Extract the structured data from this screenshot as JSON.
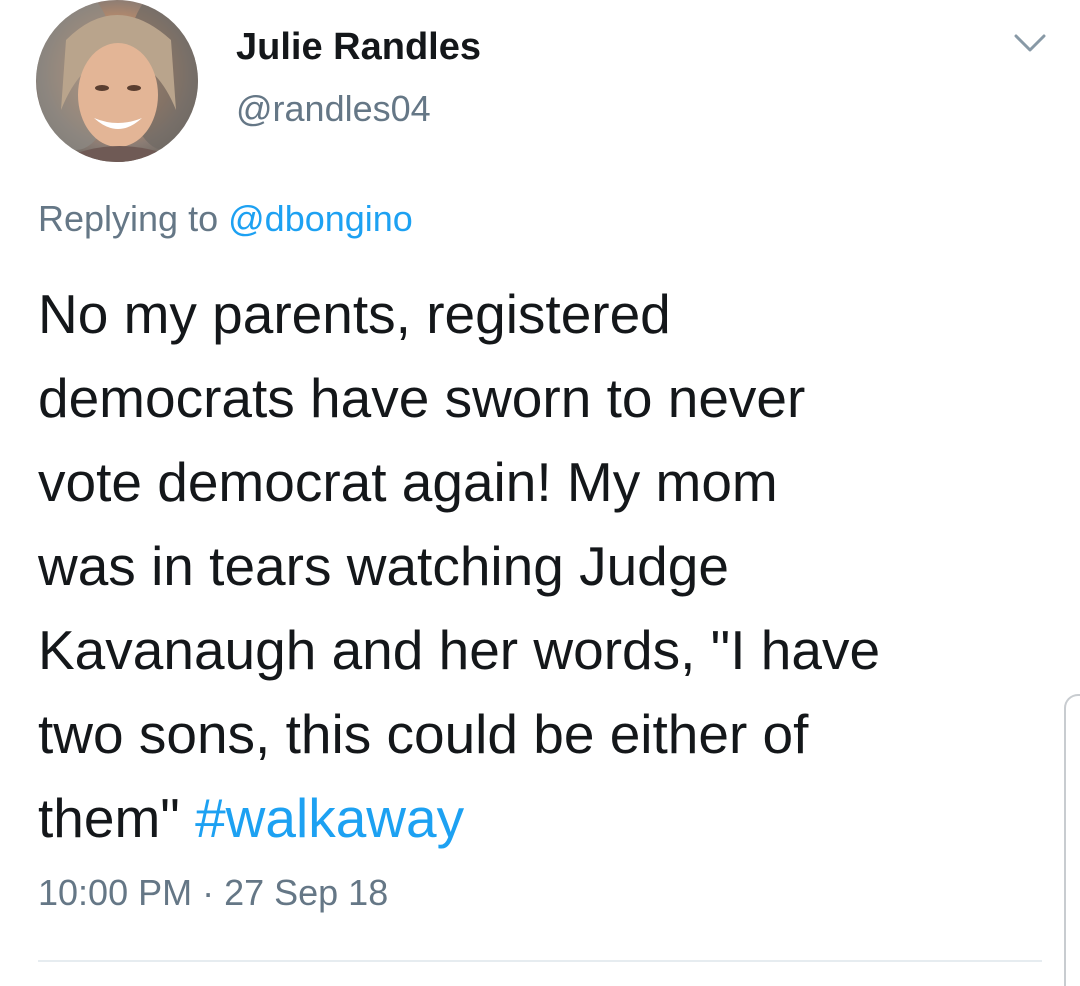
{
  "tweet": {
    "author": {
      "display_name": "Julie Randles",
      "handle": "@randles04",
      "avatar_icon": "profile-photo"
    },
    "menu_icon": "chevron-down-icon",
    "reply": {
      "prefix": "Replying to",
      "mention": "@dbongino"
    },
    "body_lines": [
      "No my parents, registered",
      "democrats have sworn to never",
      "vote democrat again! My mom",
      "was in tears watching Judge",
      "Kavanaugh and her words, \"I have",
      "two sons, this could be either of",
      "them\""
    ],
    "hashtag": "#walkaway",
    "timestamp": "10:00 PM · 27 Sep 18"
  },
  "colors": {
    "text": "#14171a",
    "secondary": "#657786",
    "link": "#1da1f2",
    "divider": "#e6ecf0"
  }
}
